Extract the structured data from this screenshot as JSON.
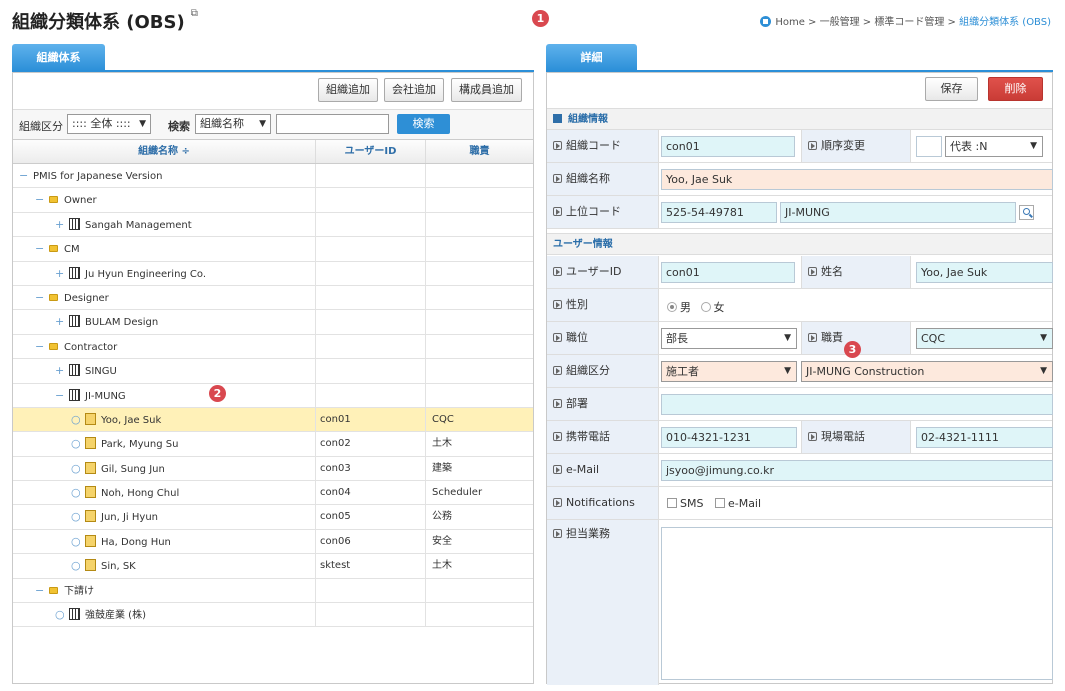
{
  "header": {
    "title": "組織分類体系 (OBS)",
    "breadcrumb": {
      "home": "Home",
      "sep": " > ",
      "path1": "一般管理",
      "path2": "標準コード管理",
      "current": "組織分類体系 (OBS)"
    }
  },
  "markers": {
    "m1": "1",
    "m2": "2",
    "m3": "3"
  },
  "left": {
    "tab": "組織体系",
    "buttons": {
      "add_org": "組織追加",
      "add_company": "会社追加",
      "add_member": "構成員追加"
    },
    "search": {
      "org_type_label": "組織区分",
      "org_type_value": ":::: 全体 ::::",
      "search_label": "検索",
      "search_field_value": "組織名称",
      "search_input_value": "",
      "search_button": "検索"
    },
    "columns": {
      "name": "組織名称 ÷",
      "user_id": "ユーザーID",
      "role": "職責"
    },
    "rows": [
      {
        "level": 0,
        "toggle": "−",
        "icon": "none",
        "name": "PMIS for Japanese Version",
        "uid": "",
        "role": ""
      },
      {
        "level": 1,
        "toggle": "−",
        "icon": "folder",
        "name": "Owner",
        "uid": "",
        "role": ""
      },
      {
        "level": 2,
        "toggle": "+",
        "icon": "building",
        "name": "Sangah Management",
        "uid": "",
        "role": ""
      },
      {
        "level": 1,
        "toggle": "−",
        "icon": "folder",
        "name": "CM",
        "uid": "",
        "role": ""
      },
      {
        "level": 2,
        "toggle": "+",
        "icon": "building",
        "name": "Ju Hyun Engineering Co.",
        "uid": "",
        "role": ""
      },
      {
        "level": 1,
        "toggle": "−",
        "icon": "folder",
        "name": "Designer",
        "uid": "",
        "role": ""
      },
      {
        "level": 2,
        "toggle": "+",
        "icon": "building",
        "name": "BULAM  Design",
        "uid": "",
        "role": ""
      },
      {
        "level": 1,
        "toggle": "−",
        "icon": "folder",
        "name": "Contractor",
        "uid": "",
        "role": ""
      },
      {
        "level": 2,
        "toggle": "+",
        "icon": "building",
        "name": "SINGU",
        "uid": "",
        "role": ""
      },
      {
        "level": 2,
        "toggle": "−",
        "icon": "building",
        "name": "JI-MUNG",
        "uid": "",
        "role": ""
      },
      {
        "level": 3,
        "toggle": "○",
        "icon": "user",
        "name": "Yoo, Jae Suk",
        "uid": "con01",
        "role": "CQC",
        "selected": true
      },
      {
        "level": 3,
        "toggle": "○",
        "icon": "user",
        "name": "Park, Myung Su",
        "uid": "con02",
        "role": "土木"
      },
      {
        "level": 3,
        "toggle": "○",
        "icon": "user",
        "name": "Gil, Sung Jun",
        "uid": "con03",
        "role": "建築"
      },
      {
        "level": 3,
        "toggle": "○",
        "icon": "user",
        "name": "Noh, Hong Chul",
        "uid": "con04",
        "role": "Scheduler"
      },
      {
        "level": 3,
        "toggle": "○",
        "icon": "user",
        "name": "Jun, Ji Hyun",
        "uid": "con05",
        "role": "公務"
      },
      {
        "level": 3,
        "toggle": "○",
        "icon": "user",
        "name": "Ha, Dong Hun",
        "uid": "con06",
        "role": "安全"
      },
      {
        "level": 3,
        "toggle": "○",
        "icon": "user",
        "name": "Sin, SK",
        "uid": "sktest",
        "role": "土木"
      },
      {
        "level": 1,
        "toggle": "−",
        "icon": "folder",
        "name": "下請け",
        "uid": "",
        "role": ""
      },
      {
        "level": 2,
        "toggle": "○",
        "icon": "building",
        "name": "強鼓産業 (株)",
        "uid": "",
        "role": ""
      }
    ]
  },
  "right": {
    "tab": "詳細",
    "buttons": {
      "save": "保存",
      "delete": "削除"
    },
    "org_section": "組織情報",
    "user_section": "ユーザー情報",
    "fields": {
      "org_code_label": "組織コード",
      "org_code": "con01",
      "order_label": "順序変更",
      "order_value": "",
      "order_select": "代表 :N",
      "org_name_label": "組織名称",
      "org_name": "Yoo, Jae Suk",
      "parent_code_label": "上位コード",
      "parent_code": "525-54-49781",
      "parent_name": "JI-MUNG",
      "user_id_label": "ユーザーID",
      "user_id": "con01",
      "full_name_label": "姓名",
      "full_name": "Yoo, Jae Suk",
      "gender_label": "性別",
      "gender_male": "男",
      "gender_female": "女",
      "position_label": "職位",
      "position": "部長",
      "role_label": "職責",
      "role": "CQC",
      "org_type_label": "組織区分",
      "org_type": "施工者",
      "company": "JI-MUNG Construction",
      "dept_label": "部署",
      "dept": "",
      "mobile_label": "携帯電話",
      "mobile": "010-4321-1231",
      "site_phone_label": "現場電話",
      "site_phone": "02-4321-1111",
      "email_label": "e-Mail",
      "email": "jsyoo@jimung.co.kr",
      "notif_label": "Notifications",
      "notif_sms": "SMS",
      "notif_email": "e-Mail",
      "duty_label": "担当業務",
      "duty": ""
    }
  }
}
